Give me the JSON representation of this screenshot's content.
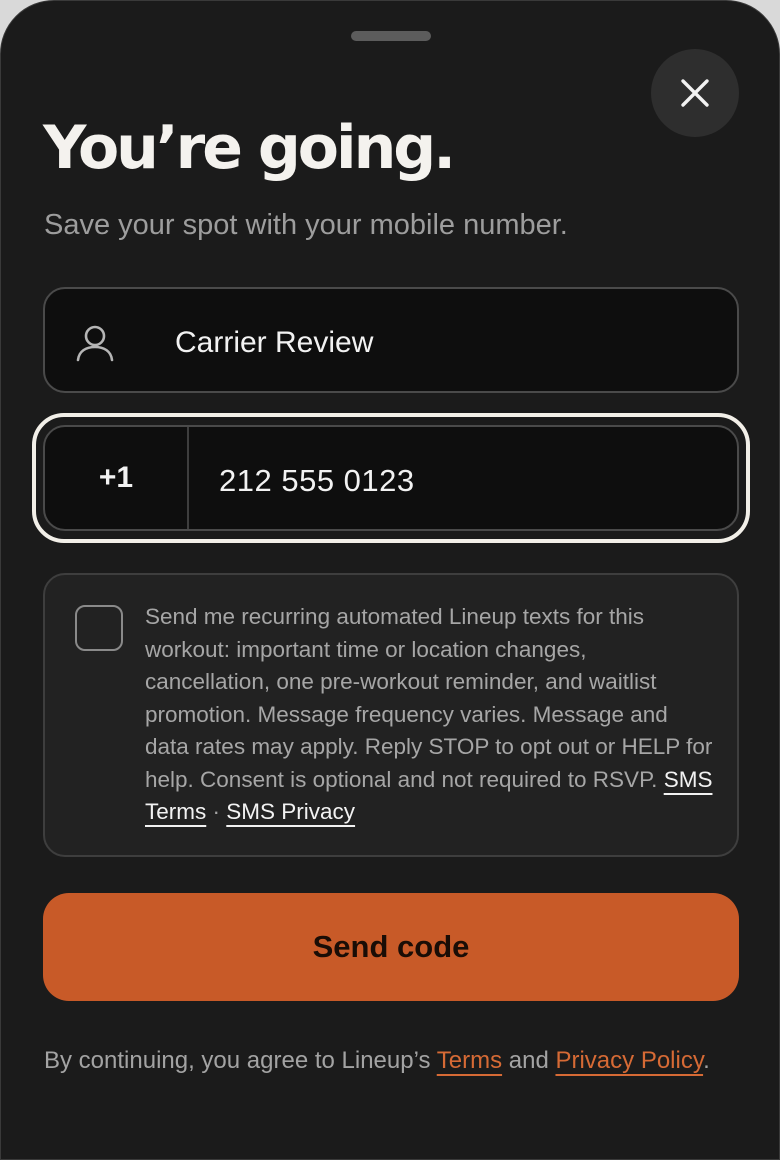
{
  "sheet": {
    "title": "You’re going.",
    "subtitle": "Save your spot with your mobile number."
  },
  "icons": {
    "close": "close-icon",
    "user": "user-icon"
  },
  "name_field": {
    "value": "Carrier Review"
  },
  "phone_field": {
    "country_code": "+1",
    "value": "212 555 0123"
  },
  "consent": {
    "checked": false,
    "text": "Send me recurring automated Lineup texts for this workout: important time or location changes, cancellation, one pre-workout reminder, and waitlist promotion. Message frequency varies. Message and data rates may apply. Reply STOP to opt out or HELP for help. Consent is optional and not required to RSVP.",
    "sms_terms": "SMS Terms",
    "separator": "·",
    "sms_privacy": "SMS Privacy"
  },
  "actions": {
    "send_code": "Send code"
  },
  "footer": {
    "prefix": "By continuing, you agree to Lineup’s",
    "terms": "Terms",
    "and": "and",
    "privacy": "Privacy Policy",
    "suffix": "."
  },
  "colors": {
    "accent": "#c85a28",
    "link": "#d66a35",
    "background": "#1b1b1b"
  }
}
